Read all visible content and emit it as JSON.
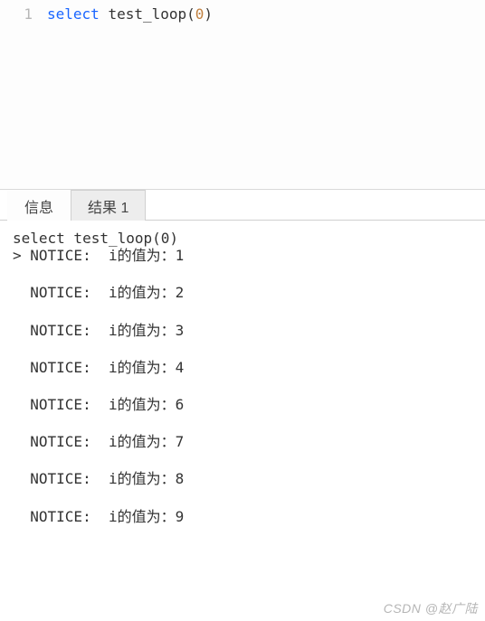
{
  "editor": {
    "line_number": "1",
    "sql": {
      "keyword": "select",
      "func": "test_loop",
      "open": "(",
      "arg": "0",
      "close": ")"
    }
  },
  "tabs": {
    "info_label": "信息",
    "results_label": "结果 1",
    "active_index": 0
  },
  "output": {
    "echo_line": "select test_loop(0)",
    "prompt": "> ",
    "notice_prefix": "NOTICE:  ",
    "message_prefix": "i的值为：",
    "lines": [
      {
        "value": "1",
        "leading": true
      },
      {
        "value": "2"
      },
      {
        "value": "3"
      },
      {
        "value": "4"
      },
      {
        "value": "6"
      },
      {
        "value": "7"
      },
      {
        "value": "8"
      },
      {
        "value": "9"
      }
    ]
  },
  "watermark": "CSDN @赵广陆"
}
